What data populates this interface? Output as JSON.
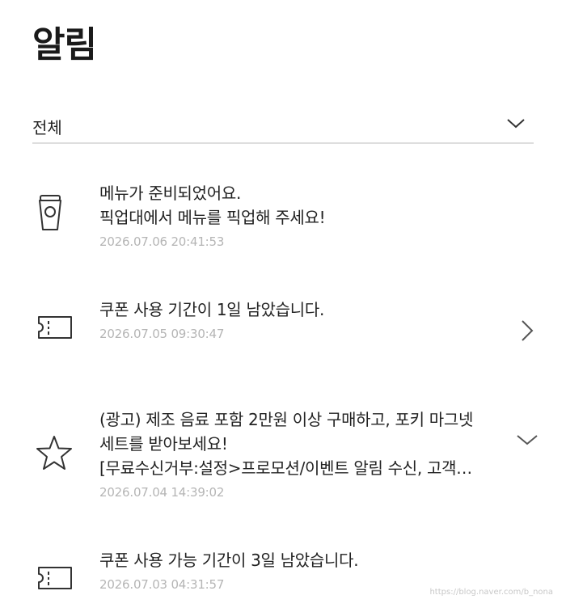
{
  "page": {
    "title": "알림"
  },
  "filter": {
    "label": "전체",
    "icon": "chevron-down-icon"
  },
  "notifications": [
    {
      "icon": "cup-icon",
      "line1": "메뉴가 준비되었어요.",
      "line2": "픽업대에서 메뉴를 픽업해 주세요!",
      "time": "2026.07.06 20:41:53"
    },
    {
      "icon": "ticket-icon",
      "line1": "쿠폰 사용 기간이 1일 남았습니다.",
      "time": "2026.07.05 09:30:47",
      "action": "chevron-right-icon"
    },
    {
      "icon": "star-icon",
      "line1": "(광고) 제조 음료 포함 2만원 이상 구매하고, 포키 마그넷",
      "line2": "세트를 받아보세요!",
      "line3": "[무료수신거부:설정>프로모션/이벤트 알림 수신, 고객…",
      "time": "2026.07.04 14:39:02",
      "action": "chevron-down-icon"
    },
    {
      "icon": "ticket-icon",
      "line1": "쿠폰 사용 가능 기간이 3일 남았습니다.",
      "time": "2026.07.03 04:31:57"
    }
  ],
  "watermark": "https://blog.naver.com/b_nona"
}
